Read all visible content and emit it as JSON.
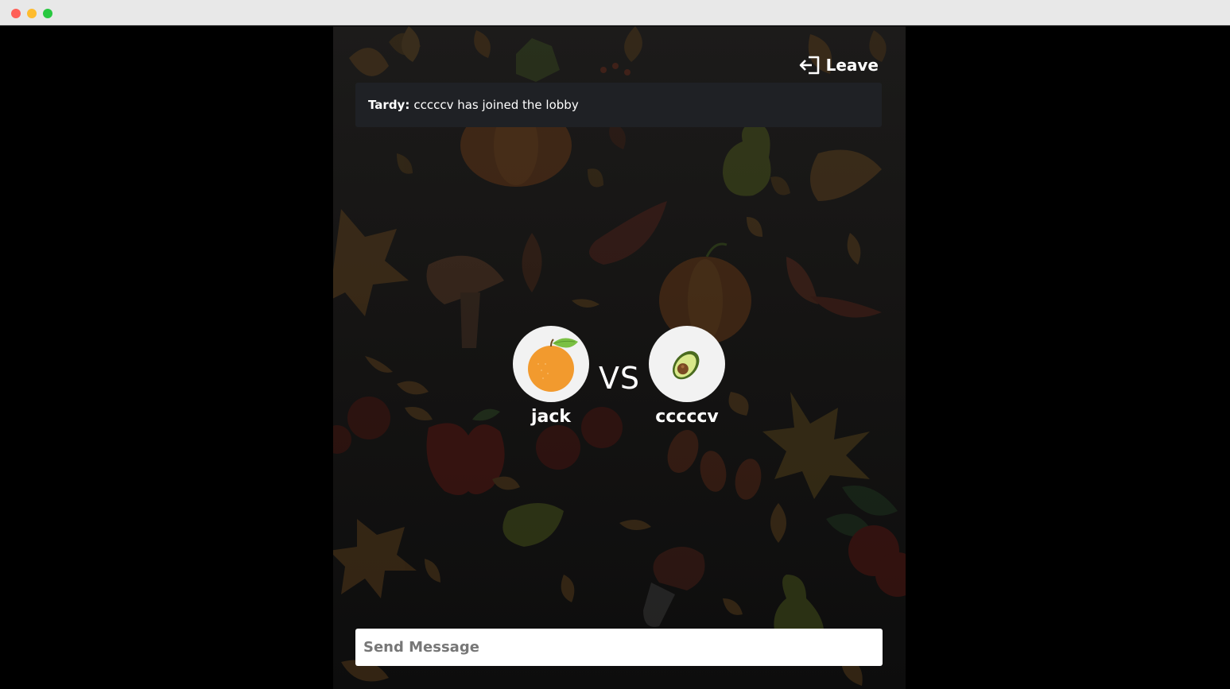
{
  "window": {
    "controls": [
      "close",
      "minimize",
      "maximize"
    ]
  },
  "header": {
    "leave_label": "Leave",
    "leave_icon": "sign-out-icon"
  },
  "chat": {
    "messages": [
      {
        "sender": "Tardy:",
        "text": "cccccv has joined the lobby"
      }
    ]
  },
  "match": {
    "vs_label": "VS",
    "players": [
      {
        "name": "jack",
        "avatar": "orange-icon"
      },
      {
        "name": "cccccv",
        "avatar": "avocado-icon"
      }
    ]
  },
  "composer": {
    "placeholder": "Send Message",
    "value": ""
  },
  "colors": {
    "page_background": "#000000",
    "panel_background": "#161514",
    "chat_background": "#1f2125",
    "text": "#ffffff",
    "input_background": "#ffffff",
    "placeholder": "#777777"
  }
}
